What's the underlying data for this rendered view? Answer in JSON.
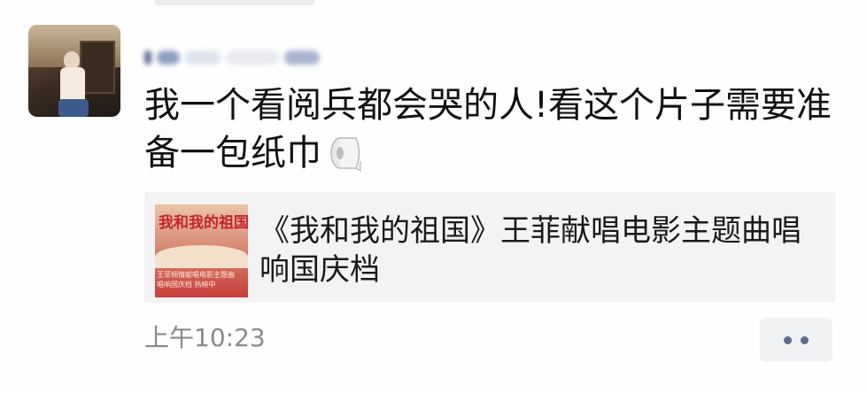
{
  "post": {
    "author_name": "",
    "text": "我一个看阅兵都会哭的人!看这个片子需要准备一包纸巾",
    "emoji": "toilet-paper-icon",
    "timestamp": "上午10:23"
  },
  "link_card": {
    "thumbnail_title": "我和我的祖国",
    "thumbnail_caption_line1": "王菲倾情献唱电影主题曲",
    "thumbnail_caption_line2": "唱响国庆档 热映中",
    "title": "《我和我的祖国》王菲献唱电影主题曲唱响国庆档"
  },
  "actions": {
    "more_icon": "more-dots-icon"
  },
  "colors": {
    "name_link": "#576b95",
    "timestamp": "#8a8a8a",
    "card_background": "#f3f3f5",
    "dots": "#5b6b8c"
  }
}
